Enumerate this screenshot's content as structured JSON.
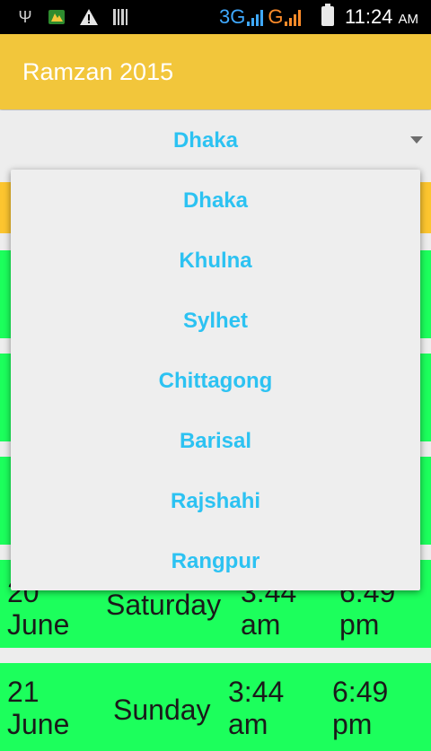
{
  "status_bar": {
    "icons": [
      "usb-icon",
      "app-notification-icon",
      "warning-icon",
      "barcode-icon"
    ],
    "network_3g": "3G",
    "network_g": "G",
    "time": "11:24",
    "ampm": "AM",
    "colors": {
      "network_3g": "#3fa9ff",
      "network_g": "#ff8c2a"
    }
  },
  "app_bar": {
    "title": "Ramzan 2015",
    "color": "#f2c63b"
  },
  "spinner": {
    "selected": "Dhaka"
  },
  "dropdown": {
    "options": [
      "Dhaka",
      "Khulna",
      "Sylhet",
      "Chittagong",
      "Barisal",
      "Rajshahi",
      "Rangpur"
    ]
  },
  "table": {
    "row_color": "#1cff5c",
    "header_color": "#fcc52f",
    "rows": [
      {
        "date_day": "20",
        "date_month": "June",
        "weekday": "Saturday",
        "sehri_time": "3:44",
        "sehri_period": "am",
        "iftar_time": "6:49",
        "iftar_period": "pm"
      },
      {
        "date_day": "21",
        "date_month": "June",
        "weekday": "Sunday",
        "sehri_time": "3:44",
        "sehri_period": "am",
        "iftar_time": "6:49",
        "iftar_period": "pm"
      }
    ]
  }
}
